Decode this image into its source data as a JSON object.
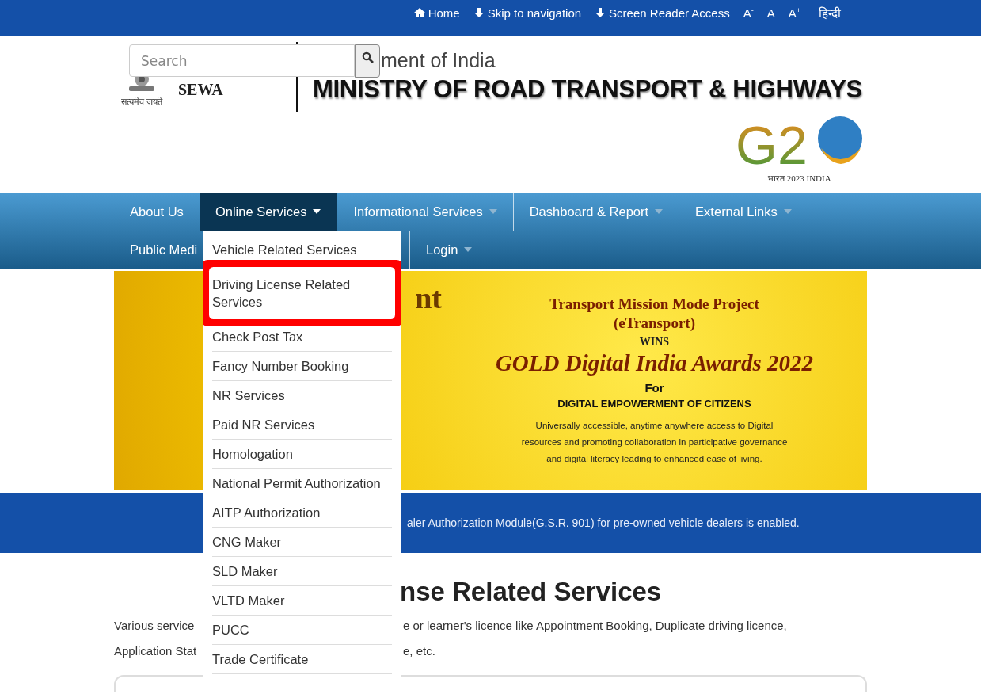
{
  "top_bar": {
    "links": [
      {
        "kind": "home",
        "label": "Home"
      },
      {
        "kind": "arrow",
        "label": "Skip to navigation"
      },
      {
        "kind": "arrow",
        "label": "Screen Reader Access"
      }
    ],
    "font_sizes": [
      "A$^{-}$",
      "A",
      "A$^{+}$"
    ],
    "language": "हिन्दी"
  },
  "header": {
    "emblem_motto": "सत्यमेव जयते",
    "portal_name": "SEWA",
    "government": "ment of India",
    "ministry": "MINISTRY OF ROAD TRANSPORT & HIGHWAYS",
    "search": {
      "placeholder": "Search"
    },
    "g20": {
      "mark": "G2",
      "tagline": "भारत 2023 INDIA"
    }
  },
  "nav": {
    "items": [
      {
        "label": "About Us",
        "caret": false,
        "selected": false
      },
      {
        "label": "Online Services",
        "caret": true,
        "selected": true
      },
      {
        "label": "Informational Services",
        "caret": true,
        "selected": false
      },
      {
        "label": "Dashboard & Report",
        "caret": true,
        "selected": false
      },
      {
        "label": "External Links",
        "caret": true,
        "selected": false
      },
      {
        "label": "Public Medi",
        "caret": false,
        "selected": false
      },
      {
        "label": "Login",
        "caret": true,
        "selected": false
      }
    ]
  },
  "dropdown": {
    "items": [
      {
        "label": "Vehicle Related Services",
        "selected": false
      },
      {
        "label": "Driving License Related Services",
        "selected": true
      },
      {
        "label": "Check Post Tax",
        "selected": false
      },
      {
        "label": "Fancy Number Booking",
        "selected": false
      },
      {
        "label": "NR Services",
        "selected": false
      },
      {
        "label": "Paid NR Services",
        "selected": false
      },
      {
        "label": "Homologation",
        "selected": false
      },
      {
        "label": "National Permit Authorization",
        "selected": false
      },
      {
        "label": "AITP Authorization",
        "selected": false
      },
      {
        "label": "CNG Maker",
        "selected": false
      },
      {
        "label": "SLD Maker",
        "selected": false
      },
      {
        "label": "VLTD Maker",
        "selected": false
      },
      {
        "label": "PUCC",
        "selected": false
      },
      {
        "label": "Trade Certificate",
        "selected": false
      }
    ]
  },
  "banner": {
    "fragment": "nt",
    "project": "Transport Mission Mode Project",
    "project_short": "(eTransport)",
    "wins": "WINS",
    "award": "GOLD Digital India Awards 2022",
    "for": "For",
    "theme": "DIGITAL EMPOWERMENT OF CITIZENS",
    "description": [
      "Universally accessible, anytime anywhere access to Digital",
      "resources and promoting collaboration in participative governance",
      "and digital literacy leading to enhanced ease of living."
    ]
  },
  "notice": "aler Authorization Module(G.S.R. 901) for pre-owned vehicle dealers is enabled.",
  "section": {
    "heading": "nse Related Services",
    "lines": [
      [
        "Various service",
        "e or learner's licence like Appointment Booking, Duplicate driving licence,"
      ],
      [
        "Application Stat",
        "e, etc."
      ]
    ]
  }
}
